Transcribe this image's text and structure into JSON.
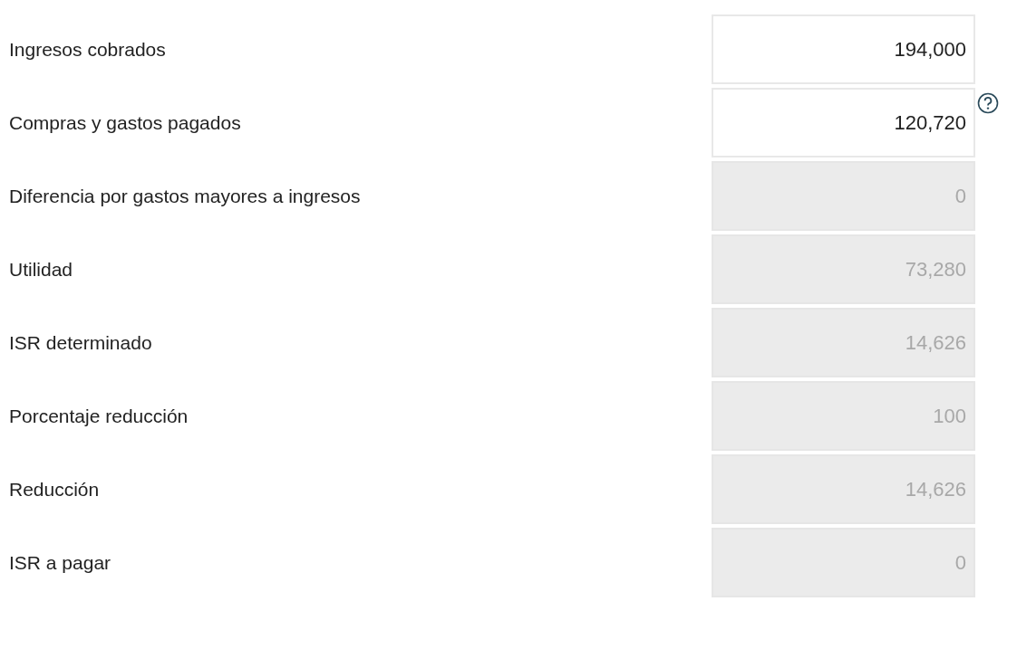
{
  "rows": [
    {
      "label": "Ingresos cobrados",
      "value": "194,000",
      "disabled": false,
      "help": false
    },
    {
      "label": "Compras y gastos pagados",
      "value": "120,720",
      "disabled": false,
      "help": true
    },
    {
      "label": "Diferencia por gastos mayores a ingresos",
      "value": "0",
      "disabled": true,
      "help": false
    },
    {
      "label": "Utilidad",
      "value": "73,280",
      "disabled": true,
      "help": false
    },
    {
      "label": "ISR determinado",
      "value": "14,626",
      "disabled": true,
      "help": false
    },
    {
      "label": "Porcentaje reducción",
      "value": "100",
      "disabled": true,
      "help": false
    },
    {
      "label": "Reducción",
      "value": "14,626",
      "disabled": true,
      "help": false
    },
    {
      "label": "ISR a pagar",
      "value": "0",
      "disabled": true,
      "help": false
    }
  ]
}
